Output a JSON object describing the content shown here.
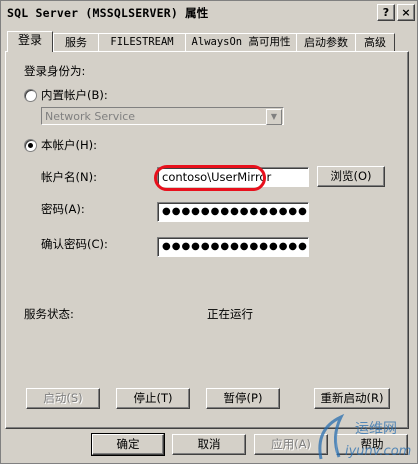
{
  "window": {
    "title": "SQL Server (MSSQLSERVER) 属性"
  },
  "titlebar": {
    "help": "?",
    "close": "×"
  },
  "tabs": [
    {
      "label": "登录",
      "selected": true
    },
    {
      "label": "服务"
    },
    {
      "label": "FILESTREAM"
    },
    {
      "label": "AlwaysOn 高可用性"
    },
    {
      "label": "启动参数"
    },
    {
      "label": "高级"
    }
  ],
  "logon": {
    "section_label": "登录身份为:",
    "builtin_label": "内置帐户(B):",
    "builtin_value": "Network Service",
    "this_account_label": "本帐户(H):",
    "account_name_label": "帐户名(N):",
    "account_name_value": "contoso\\UserMirror",
    "browse_label": "浏览(O)",
    "password_label": "密码(A):",
    "password_value": "●●●●●●●●●●●●●●●",
    "confirm_password_label": "确认密码(C):",
    "confirm_password_value": "●●●●●●●●●●●●●●●"
  },
  "status": {
    "label": "服务状态:",
    "value": "正在运行"
  },
  "service_buttons": {
    "start": "启动(S)",
    "stop": "停止(T)",
    "pause": "暂停(P)",
    "restart": "重新启动(R)"
  },
  "dialog_buttons": {
    "ok": "确定",
    "cancel": "取消",
    "apply": "应用(A)",
    "help": "帮助"
  },
  "watermark": {
    "text_top": "运维网",
    "text_bottom": "iyunv.com"
  },
  "colors": {
    "face": "#d4d0c8",
    "highlight_ring": "#e8101c",
    "watermark": "#2a6fb0"
  }
}
